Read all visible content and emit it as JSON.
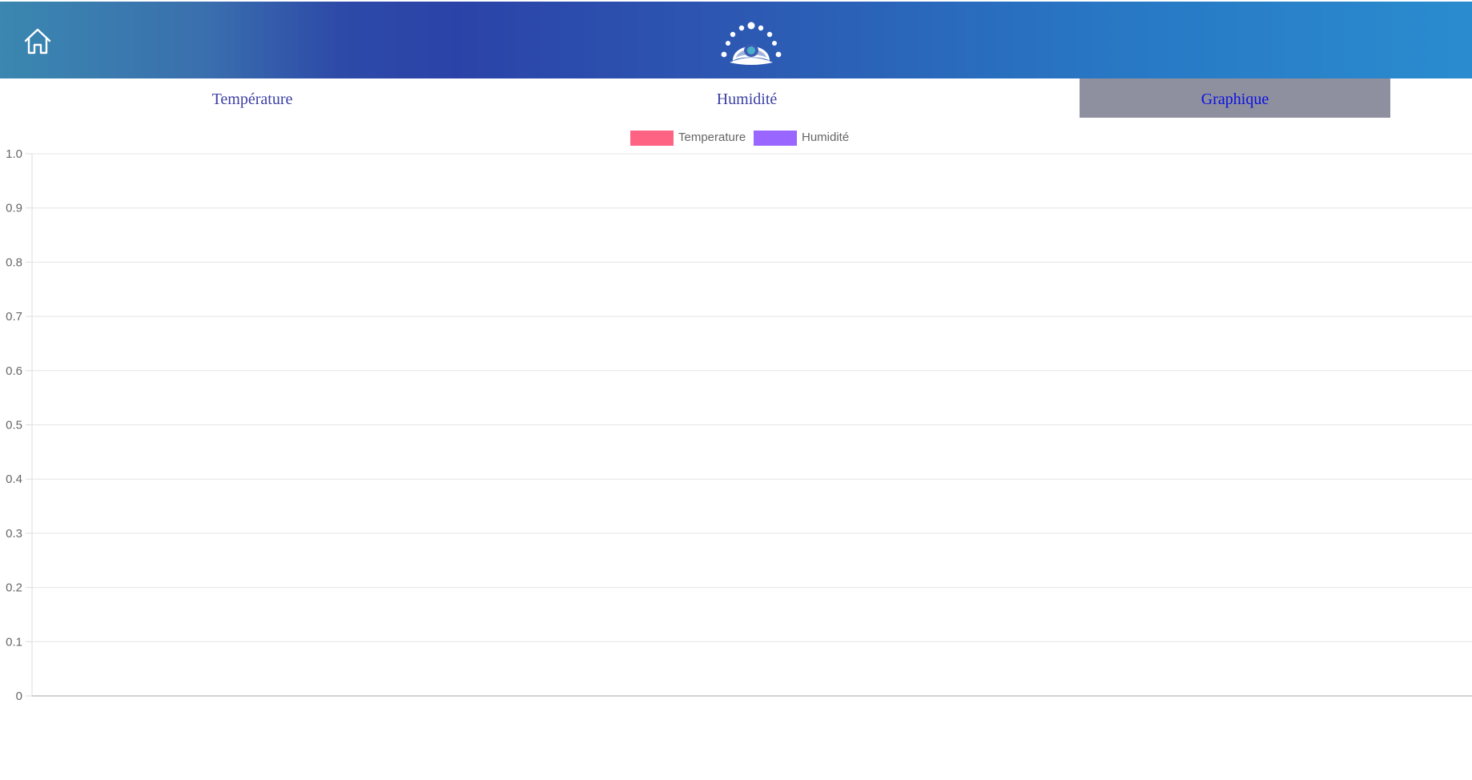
{
  "header": {
    "home_icon": "home-icon",
    "logo_icon": "logo-icon"
  },
  "tabs": [
    {
      "label": "Température",
      "active": false
    },
    {
      "label": "Humidité",
      "active": false
    },
    {
      "label": "Graphique",
      "active": true
    }
  ],
  "colors": {
    "tab_text": "#3c3fa4",
    "tab_active_bg": "#8e8f9f",
    "tab_active_text": "#0b12e0",
    "temperature": "#ff6384",
    "humidite": "#9966ff"
  },
  "chart_data": {
    "type": "line",
    "series": [
      {
        "name": "Temperature",
        "color": "#ff6384",
        "values": []
      },
      {
        "name": "Humidité",
        "color": "#9966ff",
        "values": []
      }
    ],
    "x": [],
    "ylim": [
      0,
      1.0
    ],
    "yticks": [
      "0",
      "0.1",
      "0.2",
      "0.3",
      "0.4",
      "0.5",
      "0.6",
      "0.7",
      "0.8",
      "0.9",
      "1.0"
    ],
    "grid": true,
    "legend": "top-center"
  }
}
